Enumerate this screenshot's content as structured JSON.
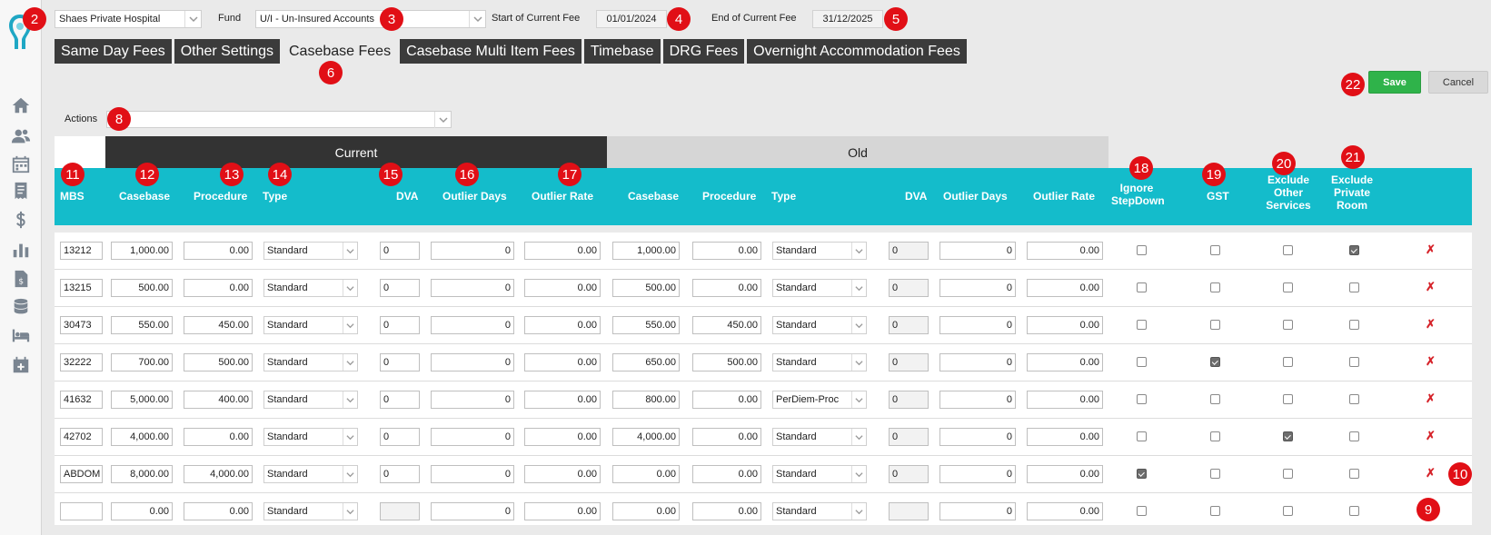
{
  "header": {
    "hospital": "Shaes Private Hospital",
    "fund_label": "Fund",
    "fund": "U/I - Un-Insured Accounts",
    "start_label": "Start of Current Fee",
    "start_date": "01/01/2024",
    "end_label": "End of Current Fee",
    "end_date": "31/12/2025"
  },
  "tabs": [
    "Same Day Fees",
    "Other Settings",
    "Casebase Fees",
    "Casebase Multi Item Fees",
    "Timebase",
    "DRG Fees",
    "Overnight Accommodation Fees"
  ],
  "active_tab": "Casebase Fees",
  "buttons": {
    "save": "Save",
    "cancel": "Cancel"
  },
  "actions": {
    "label": "Actions",
    "value": ""
  },
  "groups": {
    "current": "Current",
    "old": "Old"
  },
  "columns": {
    "mbs": "MBS",
    "casebase": "Casebase",
    "procedure": "Procedure",
    "type": "Type",
    "dva": "DVA",
    "outlier_days": "Outlier Days",
    "outlier_rate": "Outlier Rate",
    "old_casebase": "Casebase",
    "old_procedure": "Procedure",
    "old_type": "Type",
    "old_dva": "DVA",
    "old_outlier_days": "Outlier Days",
    "old_outlier_rate": "Outlier Rate",
    "ignore_stepdown": [
      "Ignore",
      "StepDown"
    ],
    "gst": "GST",
    "exclude_other": [
      "Exclude",
      "Other",
      "Services"
    ],
    "exclude_private": [
      "Exclude",
      "Private",
      "Room"
    ]
  },
  "rows": [
    {
      "mbs": "13212",
      "casebase": "1,000.00",
      "procedure": "0.00",
      "type": "Standard",
      "dva": "0",
      "outlier_days": "0",
      "outlier_rate": "0.00",
      "old_casebase": "1,000.00",
      "old_procedure": "0.00",
      "old_type": "Standard",
      "old_dva": "0",
      "old_outlier_days": "0",
      "old_outlier_rate": "0.00",
      "ignore_stepdown": false,
      "gst": false,
      "exclude_other": false,
      "exclude_private": true,
      "delete": "✗"
    },
    {
      "mbs": "13215",
      "casebase": "500.00",
      "procedure": "0.00",
      "type": "Standard",
      "dva": "0",
      "outlier_days": "0",
      "outlier_rate": "0.00",
      "old_casebase": "500.00",
      "old_procedure": "0.00",
      "old_type": "Standard",
      "old_dva": "0",
      "old_outlier_days": "0",
      "old_outlier_rate": "0.00",
      "ignore_stepdown": false,
      "gst": false,
      "exclude_other": false,
      "exclude_private": false,
      "delete": "✗"
    },
    {
      "mbs": "30473",
      "casebase": "550.00",
      "procedure": "450.00",
      "type": "Standard",
      "dva": "0",
      "outlier_days": "0",
      "outlier_rate": "0.00",
      "old_casebase": "550.00",
      "old_procedure": "450.00",
      "old_type": "Standard",
      "old_dva": "0",
      "old_outlier_days": "0",
      "old_outlier_rate": "0.00",
      "ignore_stepdown": false,
      "gst": false,
      "exclude_other": false,
      "exclude_private": false,
      "delete": "✗"
    },
    {
      "mbs": "32222",
      "casebase": "700.00",
      "procedure": "500.00",
      "type": "Standard",
      "dva": "0",
      "outlier_days": "0",
      "outlier_rate": "0.00",
      "old_casebase": "650.00",
      "old_procedure": "500.00",
      "old_type": "Standard",
      "old_dva": "0",
      "old_outlier_days": "0",
      "old_outlier_rate": "0.00",
      "ignore_stepdown": false,
      "gst": true,
      "exclude_other": false,
      "exclude_private": false,
      "delete": "✗"
    },
    {
      "mbs": "41632",
      "casebase": "5,000.00",
      "procedure": "400.00",
      "type": "Standard",
      "dva": "0",
      "outlier_days": "0",
      "outlier_rate": "0.00",
      "old_casebase": "800.00",
      "old_procedure": "0.00",
      "old_type": "PerDiem-Proc",
      "old_dva": "0",
      "old_outlier_days": "0",
      "old_outlier_rate": "0.00",
      "ignore_stepdown": false,
      "gst": false,
      "exclude_other": false,
      "exclude_private": false,
      "delete": "✗"
    },
    {
      "mbs": "42702",
      "casebase": "4,000.00",
      "procedure": "0.00",
      "type": "Standard",
      "dva": "0",
      "outlier_days": "0",
      "outlier_rate": "0.00",
      "old_casebase": "4,000.00",
      "old_procedure": "0.00",
      "old_type": "Standard",
      "old_dva": "0",
      "old_outlier_days": "0",
      "old_outlier_rate": "0.00",
      "ignore_stepdown": false,
      "gst": false,
      "exclude_other": true,
      "exclude_private": false,
      "delete": "✗"
    },
    {
      "mbs": "ABDOM",
      "casebase": "8,000.00",
      "procedure": "4,000.00",
      "type": "Standard",
      "dva": "0",
      "outlier_days": "0",
      "outlier_rate": "0.00",
      "old_casebase": "0.00",
      "old_procedure": "0.00",
      "old_type": "Standard",
      "old_dva": "0",
      "old_outlier_days": "0",
      "old_outlier_rate": "0.00",
      "ignore_stepdown": true,
      "gst": false,
      "exclude_other": false,
      "exclude_private": false,
      "delete": "✗"
    },
    {
      "mbs": "",
      "casebase": "0.00",
      "procedure": "0.00",
      "type": "Standard",
      "dva": "",
      "outlier_days": "0",
      "outlier_rate": "0.00",
      "old_casebase": "0.00",
      "old_procedure": "0.00",
      "old_type": "Standard",
      "old_dva": "",
      "old_outlier_days": "0",
      "old_outlier_rate": "0.00",
      "ignore_stepdown": false,
      "gst": false,
      "exclude_other": false,
      "exclude_private": false,
      "delete": ""
    }
  ],
  "markers": [
    "2",
    "3",
    "4",
    "5",
    "6",
    "8",
    "9",
    "10",
    "11",
    "12",
    "13",
    "14",
    "15",
    "16",
    "17",
    "18",
    "19",
    "20",
    "21",
    "22"
  ],
  "colors": {
    "teal_header": "#14bccb",
    "dark_tab": "#3b3b3b",
    "save_green": "#2fb34a",
    "marker_red": "#e10f16"
  },
  "icons": [
    "logo-icon",
    "home-icon",
    "users-icon",
    "calendar-icon",
    "receipt-icon",
    "dollar-icon",
    "bar-chart-icon",
    "invoice-icon",
    "database-icon",
    "bed-icon",
    "calendar-plus-icon"
  ]
}
